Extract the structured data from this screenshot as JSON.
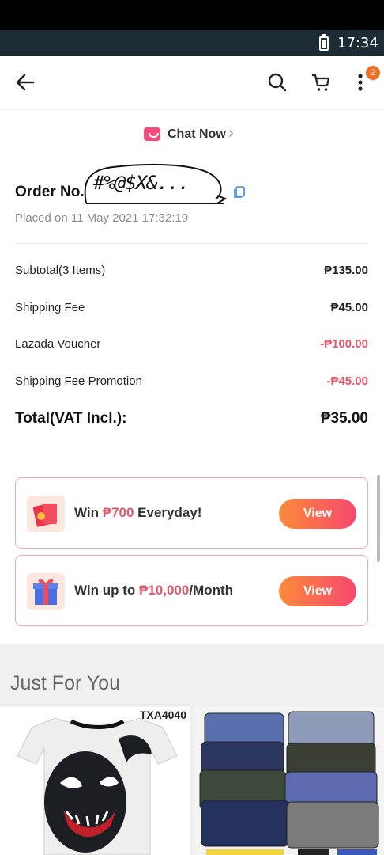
{
  "status_bar": {
    "time": "17:34"
  },
  "app_bar": {
    "back_icon": "arrow-left-icon",
    "search_icon": "search-icon",
    "cart_icon": "cart-icon",
    "more_icon": "more-vertical-icon",
    "notification_count": "2"
  },
  "chat": {
    "label": "Chat Now",
    "icon": "chat-icon",
    "chevron": "›"
  },
  "order": {
    "label": "Order No.",
    "number_redacted": "#%@$X&...",
    "placed": "Placed on 11 May 2021  17:32:19"
  },
  "summary": {
    "rows": [
      {
        "label": "Subtotal(3 Items)",
        "value": "₱135.00",
        "negative": false
      },
      {
        "label": "Shipping Fee",
        "value": "₱45.00",
        "negative": false
      },
      {
        "label": "Lazada Voucher",
        "value": "-₱100.00",
        "negative": true
      },
      {
        "label": "Shipping Fee Promotion",
        "value": "-₱45.00",
        "negative": true
      }
    ],
    "total_label": "Total(VAT Incl.):",
    "total_value": "₱35.00"
  },
  "promos": [
    {
      "prefix": "Win ",
      "highlight": "₱700",
      "suffix": " Everyday!",
      "button": "View",
      "icon": "red-envelope-icon"
    },
    {
      "prefix": "Win up to ",
      "highlight": "₱10,000",
      "suffix": "/Month",
      "button": "View",
      "icon": "gift-box-icon"
    }
  ],
  "just_for_you": {
    "title": "Just For You",
    "products": [
      {
        "sku": "TXA4040",
        "image": "venom-tshirt"
      },
      {
        "sku": "",
        "image": "boxer-shorts-pack"
      }
    ]
  },
  "colors": {
    "accent": "#f5486f",
    "negative": "#e0586b",
    "badge": "#f26c22",
    "status_bar": "#1d2b35"
  }
}
